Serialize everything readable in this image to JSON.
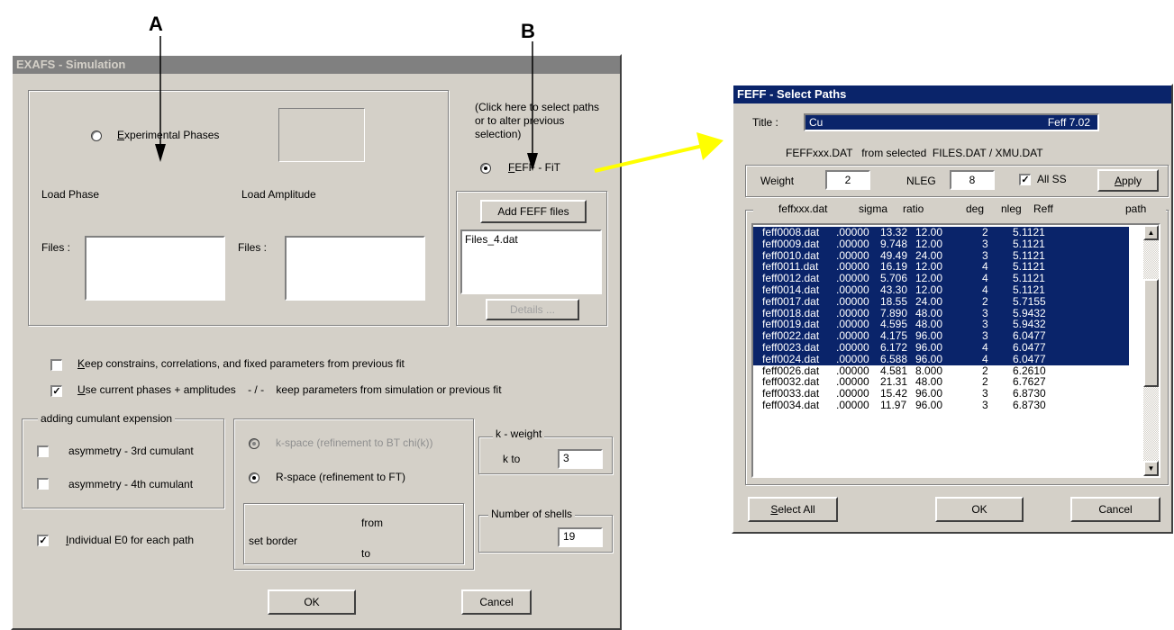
{
  "annotations": {
    "a": "A",
    "b": "B"
  },
  "sim": {
    "title": "EXAFS - Simulation",
    "exp_phases": "Experimental Phases",
    "exp_phases_u": "E",
    "load_phase": "Load Phase",
    "load_amplitude": "Load Amplitude",
    "files_label": "Files :",
    "click_hint": "(Click here to select paths or to alter previous selection)",
    "feff_fit": "FEFF  -  FiT",
    "feff_fit_u": "F",
    "add_feff": "Add FEFF files",
    "feff_file": "Files_4.dat",
    "details": "Details ...",
    "keep_constrains": "Keep constrains, correlations, and fixed parameters from previous fit",
    "keep_constrains_u": "K",
    "use_current": "Use current phases + amplitudes    - / -    keep parameters from simulation or previous fit",
    "use_current_u": "U",
    "cumulant_group": "adding cumulant expension",
    "asym3": "asymmetry - 3rd cumulant",
    "asym4": "asymmetry - 4th cumulant",
    "kspace": "k-space (refinement to BT chi(k))",
    "rspace": "R-space (refinement to FT)",
    "kweight_group": "k - weight",
    "k_to": "k  to",
    "k_value": "3",
    "set_border": "set border",
    "from": "from",
    "to": "to",
    "shells_group": "Number of shells",
    "shells_value": "19",
    "indiv_e0": "Individual E0 for each path",
    "indiv_e0_u": "I",
    "ok": "OK",
    "cancel": "Cancel"
  },
  "feff": {
    "title": "FEFF - Select Paths",
    "title_label": "Title :",
    "title_value_left": "Cu",
    "title_value_right": "Feff  7.02",
    "subtitle": "FEFFxxx.DAT   from selected  FILES.DAT / XMU.DAT",
    "weight_label": "Weight",
    "weight_value": "2",
    "nleg_label": "NLEG",
    "nleg_value": "8",
    "allss": "All SS",
    "apply": "Apply",
    "apply_u": "A",
    "col_file": "feffxxx.dat",
    "col_sigma": "sigma",
    "col_ratio": "ratio",
    "col_deg": "deg",
    "col_nleg": "nleg",
    "col_reff": "Reff",
    "col_path": "path",
    "rows": [
      {
        "file": "feff0008.dat",
        "sigma": ".00000",
        "ratio": "13.32",
        "deg": "12.00",
        "nleg": "2",
        "reff": "5.1121",
        "selected": true
      },
      {
        "file": "feff0009.dat",
        "sigma": ".00000",
        "ratio": "9.748",
        "deg": "12.00",
        "nleg": "3",
        "reff": "5.1121",
        "selected": true
      },
      {
        "file": "feff0010.dat",
        "sigma": ".00000",
        "ratio": "49.49",
        "deg": "24.00",
        "nleg": "3",
        "reff": "5.1121",
        "selected": true
      },
      {
        "file": "feff0011.dat",
        "sigma": ".00000",
        "ratio": "16.19",
        "deg": "12.00",
        "nleg": "4",
        "reff": "5.1121",
        "selected": true
      },
      {
        "file": "feff0012.dat",
        "sigma": ".00000",
        "ratio": "5.706",
        "deg": "12.00",
        "nleg": "4",
        "reff": "5.1121",
        "selected": true
      },
      {
        "file": "feff0014.dat",
        "sigma": ".00000",
        "ratio": "43.30",
        "deg": "12.00",
        "nleg": "4",
        "reff": "5.1121",
        "selected": true
      },
      {
        "file": "feff0017.dat",
        "sigma": ".00000",
        "ratio": "18.55",
        "deg": "24.00",
        "nleg": "2",
        "reff": "5.7155",
        "selected": true
      },
      {
        "file": "feff0018.dat",
        "sigma": ".00000",
        "ratio": "7.890",
        "deg": "48.00",
        "nleg": "3",
        "reff": "5.9432",
        "selected": true
      },
      {
        "file": "feff0019.dat",
        "sigma": ".00000",
        "ratio": "4.595",
        "deg": "48.00",
        "nleg": "3",
        "reff": "5.9432",
        "selected": true
      },
      {
        "file": "feff0022.dat",
        "sigma": ".00000",
        "ratio": "4.175",
        "deg": "96.00",
        "nleg": "3",
        "reff": "6.0477",
        "selected": true
      },
      {
        "file": "feff0023.dat",
        "sigma": ".00000",
        "ratio": "6.172",
        "deg": "96.00",
        "nleg": "4",
        "reff": "6.0477",
        "selected": true
      },
      {
        "file": "feff0024.dat",
        "sigma": ".00000",
        "ratio": "6.588",
        "deg": "96.00",
        "nleg": "4",
        "reff": "6.0477",
        "selected": true
      },
      {
        "file": "feff0026.dat",
        "sigma": ".00000",
        "ratio": "4.581",
        "deg": "8.000",
        "nleg": "2",
        "reff": "6.2610",
        "selected": false
      },
      {
        "file": "feff0032.dat",
        "sigma": ".00000",
        "ratio": "21.31",
        "deg": "48.00",
        "nleg": "2",
        "reff": "6.7627",
        "selected": false
      },
      {
        "file": "feff0033.dat",
        "sigma": ".00000",
        "ratio": "15.42",
        "deg": "96.00",
        "nleg": "3",
        "reff": "6.8730",
        "selected": false
      },
      {
        "file": "feff0034.dat",
        "sigma": ".00000",
        "ratio": "11.97",
        "deg": "96.00",
        "nleg": "3",
        "reff": "6.8730",
        "selected": false
      }
    ],
    "select_all": "Select All",
    "select_all_u": "S",
    "ok": "OK",
    "cancel": "Cancel"
  },
  "colors": {
    "selection": "#0a246a",
    "dialog": "#d4d0c8",
    "arrow": "#ffff00"
  }
}
